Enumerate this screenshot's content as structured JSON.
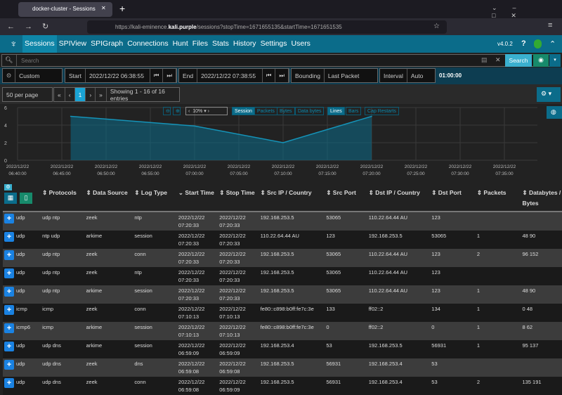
{
  "browser": {
    "tab_title": "docker-cluster - Sessions",
    "url_prefix": "https://kali-eminence.",
    "url_domain": "kali.purple",
    "url_suffix": "/sessions?stopTime=1671655135&startTime=1671651535"
  },
  "nav": {
    "items": [
      "Sessions",
      "SPIView",
      "SPIGraph",
      "Connections",
      "Hunt",
      "Files",
      "Stats",
      "History",
      "Settings",
      "Users"
    ],
    "version": "v4.0.2"
  },
  "search": {
    "placeholder": "Search",
    "button": "Search"
  },
  "time": {
    "range": "Custom",
    "start_label": "Start",
    "start": "2022/12/22 06:38:55",
    "end_label": "End",
    "end": "2022/12/22 07:38:55",
    "bounding_label": "Bounding",
    "bounding": "Last Packet",
    "interval_label": "Interval",
    "interval": "Auto",
    "duration": "01:00:00"
  },
  "pagination": {
    "per_page": "50 per page",
    "page": "1",
    "showing": "Showing 1 - 16 of 16 entries"
  },
  "chart_controls": {
    "zoom": "10%",
    "types": [
      "Session",
      "Packets",
      "Bytes",
      "Data bytes"
    ],
    "styles": [
      "Lines",
      "Bars"
    ],
    "cap": "Cap Restarts"
  },
  "chart_data": {
    "type": "area",
    "x": [
      "06:46",
      "07:00",
      "07:10",
      "07:20"
    ],
    "values": [
      5,
      3.9,
      2,
      5
    ],
    "ylim": [
      0,
      6
    ],
    "yticks": [
      "0",
      "2",
      "4",
      "6"
    ],
    "xticks": [
      [
        "2022/12/22",
        "06:40:00"
      ],
      [
        "2022/12/22",
        "06:45:00"
      ],
      [
        "2022/12/22",
        "06:50:00"
      ],
      [
        "2022/12/22",
        "06:55:00"
      ],
      [
        "2022/12/22",
        "07:00:00"
      ],
      [
        "2022/12/22",
        "07:05:00"
      ],
      [
        "2022/12/22",
        "07:10:00"
      ],
      [
        "2022/12/22",
        "07:15:00"
      ],
      [
        "2022/12/22",
        "07:20:00"
      ],
      [
        "2022/12/22",
        "07:25:00"
      ],
      [
        "2022/12/22",
        "07:30:00"
      ],
      [
        "2022/12/22",
        "07:35:00"
      ]
    ],
    "grid": true,
    "color": "#0b6c8a"
  },
  "table": {
    "columns": [
      "Protocols",
      "Data Source",
      "Log Type",
      "Start Time",
      "Stop Time",
      "Src IP / Country",
      "Src Port",
      "Dst IP / Country",
      "Dst Port",
      "Packets",
      "Databytes / Bytes"
    ],
    "rows": [
      [
        "udp",
        "udp  ntp",
        "zeek",
        "ntp",
        "2022/12/22 07:20:33",
        "2022/12/22 07:20:33",
        "192.168.253.5",
        "53065",
        "110.22.64.44 AU",
        "123",
        "",
        ""
      ],
      [
        "udp",
        "ntp  udp",
        "arkime",
        "session",
        "2022/12/22 07:20:33",
        "2022/12/22 07:20:33",
        "110.22.64.44 AU",
        "123",
        "192.168.253.5",
        "53065",
        "1",
        "48 90"
      ],
      [
        "udp",
        "udp  ntp",
        "zeek",
        "conn",
        "2022/12/22 07:20:33",
        "2022/12/22 07:20:33",
        "192.168.253.5",
        "53065",
        "110.22.64.44 AU",
        "123",
        "2",
        "96 152"
      ],
      [
        "udp",
        "udp  ntp",
        "zeek",
        "ntp",
        "2022/12/22 07:20:33",
        "2022/12/22 07:20:33",
        "192.168.253.5",
        "53065",
        "110.22.64.44 AU",
        "123",
        "",
        ""
      ],
      [
        "udp",
        "udp  ntp",
        "arkime",
        "session",
        "2022/12/22 07:20:33",
        "2022/12/22 07:20:33",
        "192.168.253.5",
        "53065",
        "110.22.64.44 AU",
        "123",
        "1",
        "48 90"
      ],
      [
        "icmp",
        "icmp",
        "zeek",
        "conn",
        "2022/12/22 07:10:13",
        "2022/12/22 07:10:13",
        "fe80::c898:b0ff:fe7c:3e",
        "133",
        "ff02::2",
        "134",
        "1",
        "0 48"
      ],
      [
        "icmp6",
        "icmp",
        "arkime",
        "session",
        "2022/12/22 07:10:13",
        "2022/12/22 07:10:13",
        "fe80::c898:b0ff:fe7c:3e",
        "0",
        "ff02::2",
        "0",
        "1",
        "8 62"
      ],
      [
        "udp",
        "udp  dns",
        "arkime",
        "session",
        "2022/12/22 06:59:09",
        "2022/12/22 06:59:09",
        "192.168.253.4",
        "53",
        "192.168.253.5",
        "56931",
        "1",
        "95 137"
      ],
      [
        "udp",
        "udp  dns",
        "zeek",
        "dns",
        "2022/12/22 06:59:08",
        "2022/12/22 06:59:08",
        "192.168.253.5",
        "56931",
        "192.168.253.4",
        "53",
        "",
        ""
      ],
      [
        "udp",
        "udp  dns",
        "zeek",
        "conn",
        "2022/12/22 06:59:08",
        "2022/12/22 06:59:09",
        "192.168.253.5",
        "56931",
        "192.168.253.4",
        "53",
        "2",
        "135 191"
      ]
    ]
  }
}
